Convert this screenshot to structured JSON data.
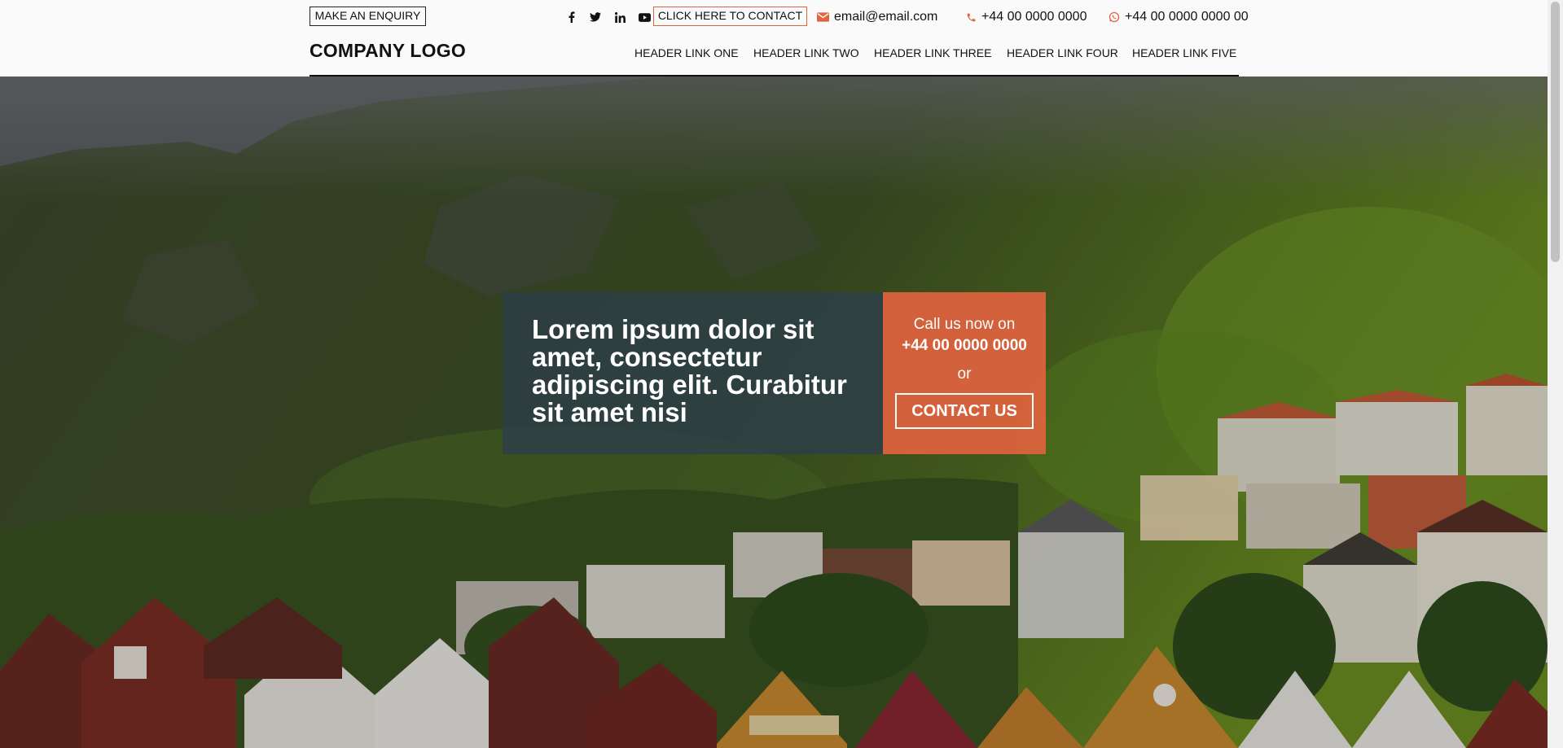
{
  "header": {
    "enquiry_label": "MAKE AN ENQUIRY",
    "socials": [
      {
        "name": "facebook-icon",
        "glyph": "f"
      },
      {
        "name": "twitter-icon",
        "glyph": "t"
      },
      {
        "name": "linkedin-icon",
        "glyph": "in"
      },
      {
        "name": "youtube-icon",
        "glyph": "▶"
      }
    ],
    "contact_label": "CLICK HERE TO CONTACT",
    "email": "email@email.com",
    "phone": "+44 00 0000 0000",
    "whatsapp": "+44 00 0000 0000 00",
    "logo": "COMPANY LOGO",
    "nav": [
      "HEADER LINK ONE",
      "HEADER LINK TWO",
      "HEADER LINK THREE",
      "HEADER LINK FOUR",
      "HEADER LINK FIVE"
    ]
  },
  "hero": {
    "headline": "Lorem ipsum dolor sit amet, consectetur adipiscing elit. Curabitur sit amet nisi",
    "call_text": "Call us now on",
    "call_number": "+44 00 0000 0000",
    "or_text": "or",
    "cta_label": "CONTACT US"
  },
  "colors": {
    "accent": "#e0643e",
    "panel_dark": "#2d3e48",
    "text": "#111111"
  }
}
